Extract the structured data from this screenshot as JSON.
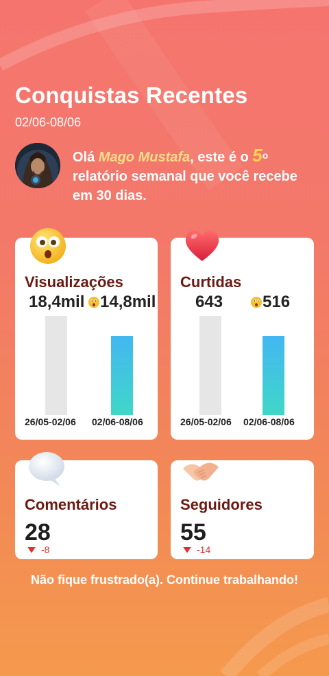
{
  "header": {
    "title": "Conquistas Recentes",
    "date_range": "02/06-08/06"
  },
  "intro": {
    "prefix": "Olá ",
    "user_name": "Mago Mustafa",
    "middle": ", este é o ",
    "report_number": "5",
    "ordinal_suffix": "o",
    "suffix": " relatório semanal que você recebe em 30 dias."
  },
  "views": {
    "title": "Visualizações",
    "previous_value": "18,4mil",
    "current_value": "14,8mil",
    "previous_period": "26/05-02/06",
    "current_period": "02/06-08/06",
    "current_fill_fraction": 0.8
  },
  "likes": {
    "title": "Curtidas",
    "previous_value": "643",
    "current_value": "516",
    "previous_period": "26/05-02/06",
    "current_period": "02/06-08/06",
    "current_fill_fraction": 0.8
  },
  "comments": {
    "title": "Comentários",
    "value": "28",
    "delta": "-8"
  },
  "followers": {
    "title": "Seguidores",
    "value": "55",
    "delta": "-14"
  },
  "footer": {
    "message": "Não fique frustrado(a). Continue trabalhando!"
  },
  "icons": {
    "views": "shocked-face-emoji",
    "likes": "red-heart-emoji",
    "comments": "speech-bubble-emoji",
    "followers": "handshake-emoji",
    "mini": "astonished-face-emoji"
  },
  "colors": {
    "card_title": "#6b1a12",
    "name_highlight": "#ffe08a",
    "decrease": "#e0302a",
    "bar_current": "#43b7f2",
    "bar_previous": "#e6e6e6"
  }
}
